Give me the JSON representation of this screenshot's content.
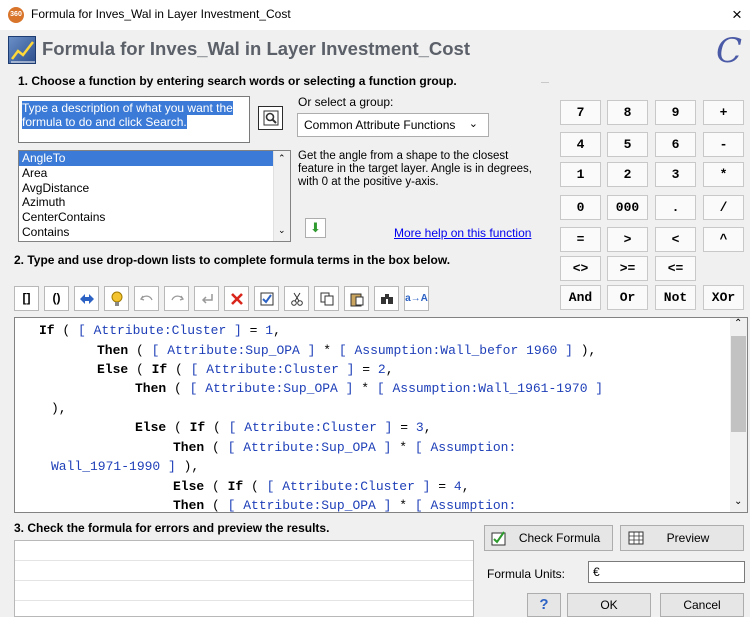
{
  "window": {
    "app_icon_text": "360",
    "title": "Formula for Inves_Wal in Layer Investment_Cost",
    "close_glyph": "×"
  },
  "header": {
    "title": "Formula for Inves_Wal in Layer Investment_Cost",
    "brand_glyph": "C"
  },
  "section1": {
    "title": "1. Choose a function by entering search words or selecting a function group.",
    "search_text": "Type a description of what you want the formula to do and click Search.",
    "group_label": "Or select a group:",
    "group_value": "Common Attribute Functions",
    "functions": [
      "AngleTo",
      "Area",
      "AvgDistance",
      "Azimuth",
      "CenterContains",
      "Contains"
    ],
    "selected_function": "AngleTo",
    "description": "Get the angle from a shape to the closest feature in the target layer.  Angle is in degrees, with 0 at the positive y-axis.",
    "more_help": "More help on this function"
  },
  "keypad": {
    "rows": [
      [
        "7",
        "8",
        "9",
        "+"
      ],
      [
        "4",
        "5",
        "6",
        "-"
      ],
      [
        "1",
        "2",
        "3",
        "*"
      ],
      [
        "0",
        "000",
        ".",
        "/"
      ],
      [
        "=",
        ">",
        "<",
        "^"
      ],
      [
        "<>",
        ">=",
        "<="
      ],
      [
        "And",
        "Or",
        "Not",
        "XOr"
      ]
    ]
  },
  "section2": {
    "title": "2. Type and use drop-down lists to complete formula terms in the box below.",
    "toolbar": [
      "[]",
      "()"
    ]
  },
  "formula_lines": [
    [
      {
        "t": "If",
        "k": "kw"
      },
      {
        "t": " ( ",
        "k": "pu"
      },
      {
        "t": "[ Attribute:Cluster ]",
        "k": "at"
      },
      {
        "t": " = ",
        "k": "pu"
      },
      {
        "t": "1",
        "k": "at"
      },
      {
        "t": ",",
        "k": "pu"
      }
    ],
    [
      {
        "t": "Then",
        "k": "kw"
      },
      {
        "t": " ( ",
        "k": "pu"
      },
      {
        "t": "[ Attribute:Sup_OPA ]",
        "k": "at"
      },
      {
        "t": " * ",
        "k": "pu"
      },
      {
        "t": "[ Assumption:Wall_befor 1960 ]",
        "k": "at"
      },
      {
        "t": " ),",
        "k": "pu"
      }
    ],
    [
      {
        "t": "Else",
        "k": "kw"
      },
      {
        "t": " ( ",
        "k": "pu"
      },
      {
        "t": "If",
        "k": "kw"
      },
      {
        "t": " ( ",
        "k": "pu"
      },
      {
        "t": "[ Attribute:Cluster ]",
        "k": "at"
      },
      {
        "t": " = ",
        "k": "pu"
      },
      {
        "t": "2",
        "k": "at"
      },
      {
        "t": ",",
        "k": "pu"
      }
    ],
    [
      {
        "t": "Then",
        "k": "kw"
      },
      {
        "t": " ( ",
        "k": "pu"
      },
      {
        "t": "[ Attribute:Sup_OPA ]",
        "k": "at"
      },
      {
        "t": " * ",
        "k": "pu"
      },
      {
        "t": "[ Assumption:Wall_1961-1970 ]",
        "k": "at"
      }
    ],
    [
      {
        "t": "),",
        "k": "pu"
      }
    ],
    [
      {
        "t": "Else",
        "k": "kw"
      },
      {
        "t": " ( ",
        "k": "pu"
      },
      {
        "t": "If",
        "k": "kw"
      },
      {
        "t": " ( ",
        "k": "pu"
      },
      {
        "t": "[ Attribute:Cluster ]",
        "k": "at"
      },
      {
        "t": " = ",
        "k": "pu"
      },
      {
        "t": "3",
        "k": "at"
      },
      {
        "t": ",",
        "k": "pu"
      }
    ],
    [
      {
        "t": "Then",
        "k": "kw"
      },
      {
        "t": " ( ",
        "k": "pu"
      },
      {
        "t": "[ Attribute:Sup_OPA ]",
        "k": "at"
      },
      {
        "t": " * ",
        "k": "pu"
      },
      {
        "t": "[ Assumption:",
        "k": "at"
      }
    ],
    [
      {
        "t": "Wall_1971-1990 ]",
        "k": "at"
      },
      {
        "t": " ),",
        "k": "pu"
      }
    ],
    [
      {
        "t": "Else",
        "k": "kw"
      },
      {
        "t": " ( ",
        "k": "pu"
      },
      {
        "t": "If",
        "k": "kw"
      },
      {
        "t": " ( ",
        "k": "pu"
      },
      {
        "t": "[ Attribute:Cluster ]",
        "k": "at"
      },
      {
        "t": " = ",
        "k": "pu"
      },
      {
        "t": "4",
        "k": "at"
      },
      {
        "t": ",",
        "k": "pu"
      }
    ],
    [
      {
        "t": "Then",
        "k": "kw"
      },
      {
        "t": " ( ",
        "k": "pu"
      },
      {
        "t": "[ Attribute:Sup_OPA ]",
        "k": "at"
      },
      {
        "t": " * ",
        "k": "pu"
      },
      {
        "t": "[ Assumption:",
        "k": "at"
      }
    ]
  ],
  "section3": {
    "title": "3. Check the formula for errors and preview the results.",
    "check_label": "Check Formula",
    "preview_label": "Preview",
    "units_label": "Formula Units:",
    "units_value": "€",
    "help_glyph": "?",
    "ok_label": "OK",
    "cancel_label": "Cancel"
  }
}
